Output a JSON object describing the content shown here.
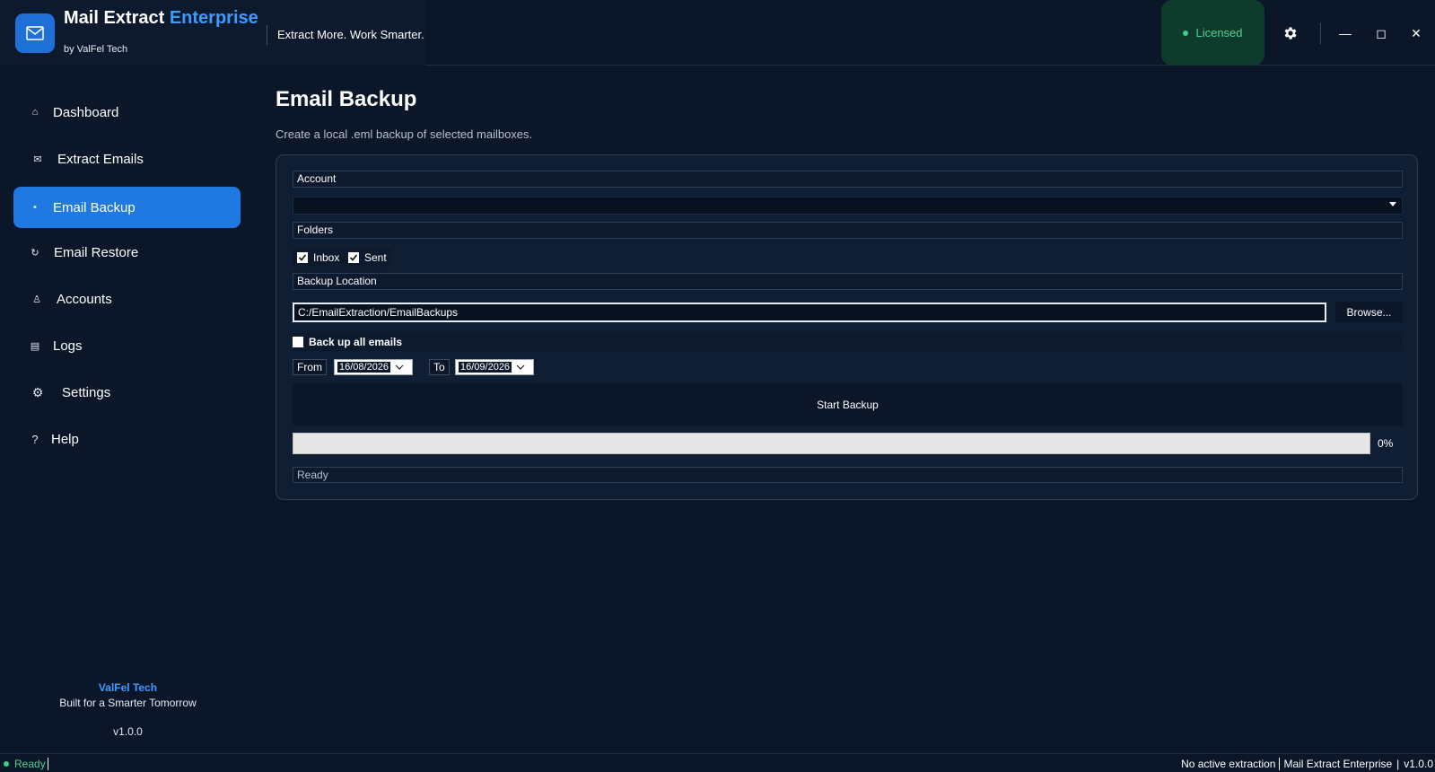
{
  "app": {
    "name_main": "Mail Extract",
    "name_accent": "Enterprise",
    "byline": "by ValFel Tech",
    "tagline": "Extract More. Work Smarter."
  },
  "header": {
    "license_label": "Licensed",
    "minimize_label": "—",
    "maximize_label": "◻",
    "close_label": "✕"
  },
  "sidebar": {
    "items": [
      {
        "label": "Dashboard",
        "icon": "home-icon",
        "glyph": "⌂"
      },
      {
        "label": "Extract Emails",
        "icon": "envelope-icon",
        "glyph": "✉"
      },
      {
        "label": "Email Backup",
        "icon": "backup-icon",
        "glyph": "▪",
        "active": true
      },
      {
        "label": "Email Restore",
        "icon": "restore-icon",
        "glyph": "↻"
      },
      {
        "label": "Accounts",
        "icon": "user-icon",
        "glyph": "♙"
      },
      {
        "label": "Logs",
        "icon": "logs-icon",
        "glyph": "▤"
      },
      {
        "label": "Settings",
        "icon": "gear-icon",
        "glyph": "⚙"
      },
      {
        "label": "Help",
        "icon": "help-icon",
        "glyph": "?"
      }
    ],
    "footer_brand": "ValFel Tech",
    "footer_tagline": "Built for a Smarter Tomorrow",
    "footer_version": "v1.0.0"
  },
  "main": {
    "title": "Email Backup",
    "subtitle": "Create a local .eml backup of selected mailboxes.",
    "account_label": "Account",
    "account_value": "",
    "folders_label": "Folders",
    "folders": [
      {
        "label": "Inbox",
        "checked": true
      },
      {
        "label": "Sent",
        "checked": true
      }
    ],
    "backup_location_label": "Backup Location",
    "backup_location_value": "C:/EmailExtraction/EmailBackups",
    "browse_label": "Browse...",
    "backup_all_label": "Back up all emails",
    "backup_all_checked": false,
    "from_label": "From",
    "from_date": "16/08/2026",
    "to_label": "To",
    "to_date": "16/09/2026",
    "start_label": "Start Backup",
    "progress_percent": 0,
    "progress_text": "0%",
    "status_text": "Ready"
  },
  "statusbar": {
    "left_text": "Ready",
    "extraction_text": "No active extraction",
    "app_text": "Mail Extract Enterprise",
    "separator": "|",
    "version_text": "v1.0.0"
  },
  "colors": {
    "background": "#0b1628",
    "accent": "#2079e0",
    "brand_blue": "#3d9bff",
    "license_green": "#4cd38e"
  }
}
